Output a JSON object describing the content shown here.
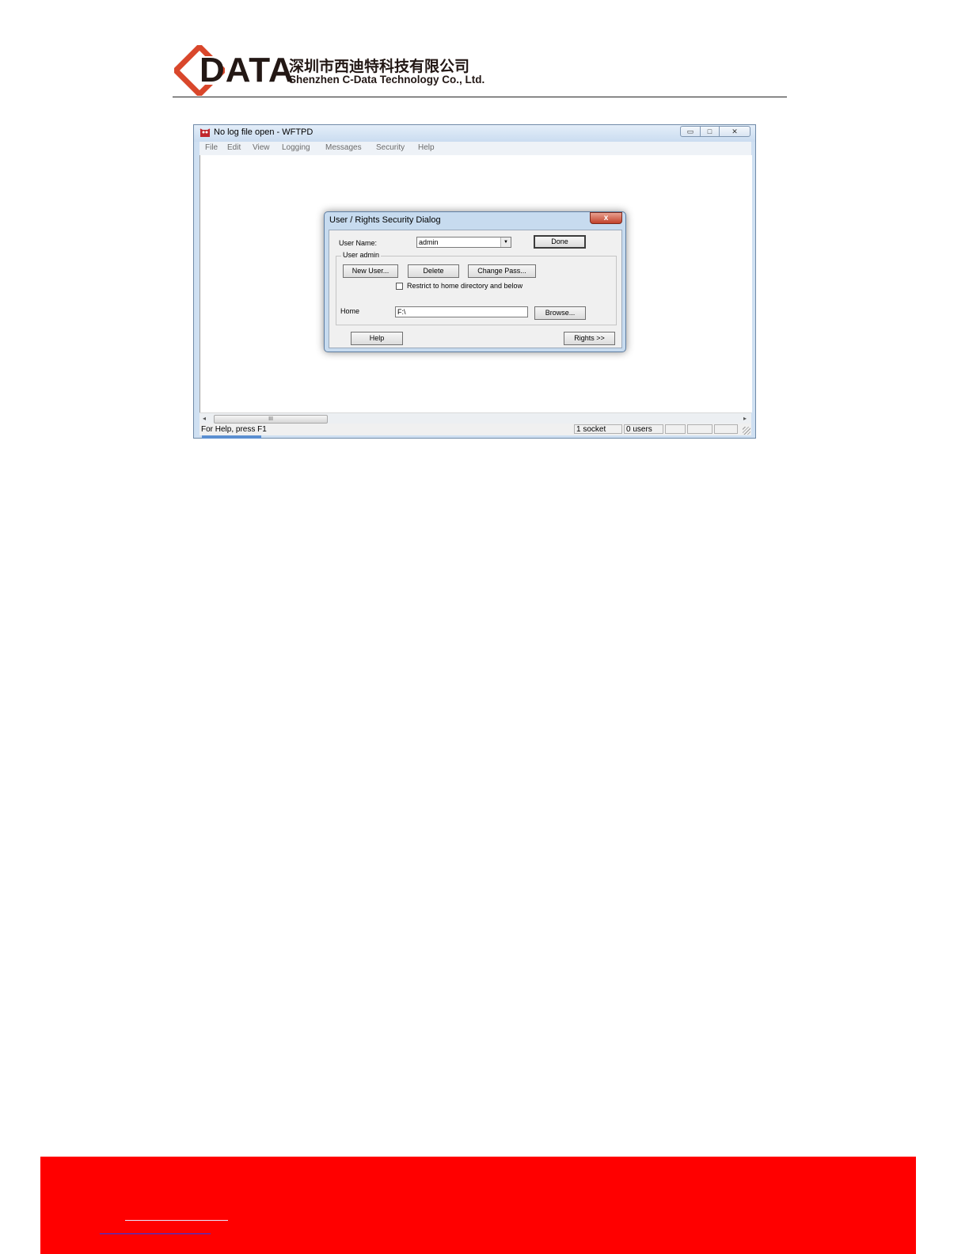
{
  "header": {
    "logo_word": "DATA",
    "company_cn": "深圳市西迪特科技有限公司",
    "company_en": "Shenzhen C-Data Technology Co., Ltd.",
    "brand_color": "#d9472b"
  },
  "window": {
    "title": "No log file open - WFTPD",
    "controls": {
      "minimize": "▭",
      "maximize": "□",
      "close": "✕"
    },
    "menu": [
      "File",
      "Edit",
      "View",
      "Logging",
      "Messages",
      "Security",
      "Help"
    ],
    "scroll_thumb_grip": "III",
    "status": {
      "help": "For Help, press F1",
      "sockets": "1 socket",
      "users": "0 users"
    }
  },
  "dialog": {
    "title": "User / Rights Security Dialog",
    "close_label": "x",
    "user_name_label": "User Name:",
    "user_name_value": "admin",
    "done_label": "Done",
    "group_label": "User admin",
    "new_user_label": "New User...",
    "delete_label": "Delete",
    "change_pass_label": "Change Pass...",
    "restrict_label": "Restrict to home directory and below",
    "restrict_checked": false,
    "home_label": "Home",
    "home_value": "F:\\",
    "browse_label": "Browse...",
    "help_label": "Help",
    "rights_label": "Rights >>"
  },
  "colors": {
    "footer": "#ff0000",
    "title_bar": "#cadcf0",
    "close_button": "#c2412a"
  }
}
